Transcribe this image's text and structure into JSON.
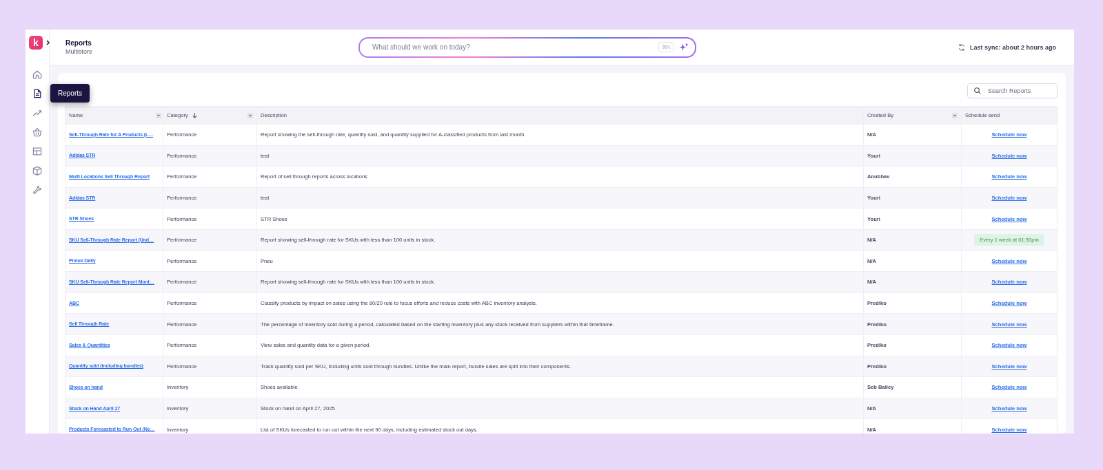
{
  "logo": {
    "letter": "k"
  },
  "sidebar": {
    "items": [
      {
        "kind": "home",
        "selected": false
      },
      {
        "kind": "document",
        "selected": true
      },
      {
        "kind": "trend",
        "selected": false
      },
      {
        "kind": "basket",
        "selected": false
      },
      {
        "kind": "panel",
        "selected": false
      },
      {
        "kind": "box",
        "selected": false
      },
      {
        "kind": "wrench",
        "selected": false
      }
    ],
    "tooltip": "Reports"
  },
  "header": {
    "title": "Reports",
    "subtitle": "Multistore",
    "search": {
      "placeholder": "What should we work on today?",
      "shortcut": "⌘K"
    },
    "sync": "Last sync: about 2 hours ago"
  },
  "search_reports": {
    "placeholder": "Search Reports"
  },
  "table": {
    "columns": [
      {
        "label": "Name",
        "filter": true,
        "sorted": false
      },
      {
        "label": "Category",
        "filter": true,
        "sorted": true
      },
      {
        "label": "Description",
        "filter": false,
        "sorted": false
      },
      {
        "label": "Created By",
        "filter": true,
        "sorted": false
      },
      {
        "label": "Schedule send",
        "filter": false,
        "sorted": false
      }
    ],
    "rows": [
      {
        "name": "Sell-Through Rate for A Products (L…",
        "category": "Performance",
        "description": "Report showing the sell-through rate, quantity sold, and quantity supplied for A-classified products from last month.",
        "created_by": "N/A",
        "schedule": {
          "kind": "link",
          "text": "Schedule now"
        }
      },
      {
        "name": "Adidas STR",
        "category": "Performance",
        "description": "test",
        "created_by": "Youri",
        "schedule": {
          "kind": "link",
          "text": "Schedule now"
        }
      },
      {
        "name": "Multi Locations Sell Through Report",
        "category": "Performance",
        "description": "Report of sell through reports across locations",
        "created_by": "Anubhav",
        "schedule": {
          "kind": "link",
          "text": "Schedule now"
        }
      },
      {
        "name": "Adidas STR",
        "category": "Performance",
        "description": "test",
        "created_by": "Youri",
        "schedule": {
          "kind": "link",
          "text": "Schedule now"
        }
      },
      {
        "name": "STR Shoes",
        "category": "Performance",
        "description": "STR Shoes",
        "created_by": "Youri",
        "schedule": {
          "kind": "link",
          "text": "Schedule now"
        }
      },
      {
        "name": "SKU Sell-Through Rate Report (Und…",
        "category": "Performance",
        "description": "Report showing sell-through rate for SKUs with less than 100 units in stock.",
        "created_by": "N/A",
        "schedule": {
          "kind": "badge",
          "text": "Every 1 week at 01:30pm"
        }
      },
      {
        "name": "Pneux Daily",
        "category": "Performance",
        "description": "Pneu",
        "created_by": "N/A",
        "schedule": {
          "kind": "link",
          "text": "Schedule now"
        }
      },
      {
        "name": "SKU Sell-Through Rate Report Mont…",
        "category": "Performance",
        "description": "Report showing sell-through rate for SKUs with less than 100 units in stock.",
        "created_by": "N/A",
        "schedule": {
          "kind": "link",
          "text": "Schedule now"
        }
      },
      {
        "name": "ABC",
        "category": "Performance",
        "description": "Classify products by impact on sales using the 80/20 rule to focus efforts and reduce costs with ABC inventory analysis.",
        "created_by": "Prediko",
        "schedule": {
          "kind": "link",
          "text": "Schedule now"
        }
      },
      {
        "name": "Sell Through Rate",
        "category": "Performance",
        "description": "The percentage of inventory sold during a period, calculated based on the starting inventory plus any stock received from suppliers within that timeframe.",
        "created_by": "Prediko",
        "schedule": {
          "kind": "link",
          "text": "Schedule now"
        }
      },
      {
        "name": "Sales & Quantities",
        "category": "Performance",
        "description": "View sales and quantity data for a given period.",
        "created_by": "Prediko",
        "schedule": {
          "kind": "link",
          "text": "Schedule now"
        }
      },
      {
        "name": "Quantity sold (including bundles)",
        "category": "Performance",
        "description": "Track quantity sold per SKU, including units sold through bundles. Unlike the main report, bundle sales are split into their components.",
        "created_by": "Prediko",
        "schedule": {
          "kind": "link",
          "text": "Schedule now"
        }
      },
      {
        "name": "Shoes on hand",
        "category": "Inventory",
        "description": "Shoes available",
        "created_by": "Seb Bailey",
        "schedule": {
          "kind": "link",
          "text": "Schedule now"
        }
      },
      {
        "name": "Stock on Hand April 27",
        "category": "Inventory",
        "description": "Stock on hand on April 27, 2025",
        "created_by": "N/A",
        "schedule": {
          "kind": "link",
          "text": "Schedule now"
        }
      },
      {
        "name": "Products Forecasted to Run Out (Ne…",
        "category": "Inventory",
        "description": "List of SKUs forecasted to run out within the next 90 days, including estimated stock out days.",
        "created_by": "N/A",
        "schedule": {
          "kind": "link",
          "text": "Schedule now"
        }
      }
    ]
  }
}
